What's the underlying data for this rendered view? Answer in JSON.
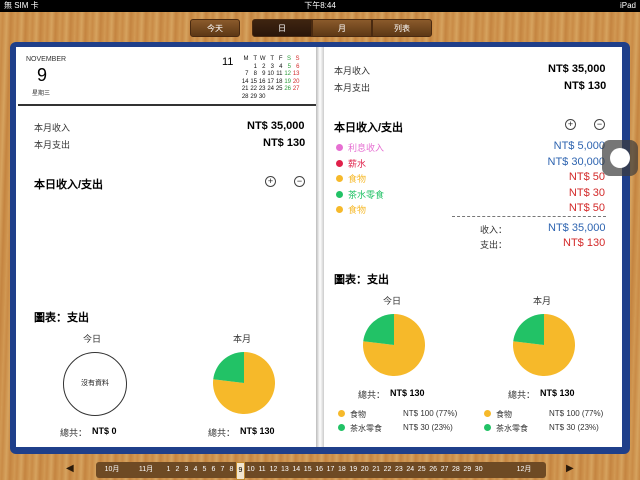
{
  "status": {
    "carrier": "無 SIM 卡",
    "time": "下午8:44",
    "ipad": "iPad"
  },
  "segments": {
    "today": "今天",
    "day": "日",
    "month": "月",
    "list": "列表"
  },
  "left": {
    "cal_month": "NOVEMBER",
    "cal_day": "9",
    "cal_weekday": "星期三",
    "mini_month": "11",
    "cal_head": [
      "M",
      "T",
      "W",
      "T",
      "F",
      "S",
      "S"
    ],
    "cal_rows": [
      [
        "",
        "1",
        "2",
        "3",
        "4",
        "5",
        "6"
      ],
      [
        "7",
        "8",
        "9",
        "10",
        "11",
        "12",
        "13"
      ],
      [
        "14",
        "15",
        "16",
        "17",
        "18",
        "19",
        "20"
      ],
      [
        "21",
        "22",
        "23",
        "24",
        "25",
        "26",
        "27"
      ],
      [
        "28",
        "29",
        "30",
        "",
        "",
        "",
        ""
      ]
    ],
    "income_label": "本月收入",
    "income_value": "NT$ 35,000",
    "expense_label": "本月支出",
    "expense_value": "NT$ 130",
    "day_title": "本日收入/支出",
    "chart_title": "圖表：支出",
    "today": "今日",
    "month": "本月",
    "no_data": "沒有資料",
    "total_today": "總共：",
    "total_today_value": "NT$ 0",
    "total_month": "總共：",
    "total_month_value": "NT$ 130"
  },
  "right": {
    "income_label": "本月收入",
    "income_value": "NT$ 35,000",
    "expense_label": "本月支出",
    "expense_value": "NT$ 130",
    "day_title": "本日收入/支出",
    "items": [
      {
        "label": "利息收入",
        "value": "NT$ 5,000",
        "dot": "#e66fd2",
        "label_color": "#e66fd2",
        "value_color": "#2e64b0"
      },
      {
        "label": "薪水",
        "value": "NT$ 30,000",
        "dot": "#e0204a",
        "label_color": "#e0204a",
        "value_color": "#2e64b0"
      },
      {
        "label": "食物",
        "value": "NT$ 50",
        "dot": "#f6b92a",
        "label_color": "#f6b92a",
        "value_color": "#d32a2a"
      },
      {
        "label": "茶水零食",
        "value": "NT$ 30",
        "dot": "#22c266",
        "label_color": "#22c266",
        "value_color": "#d32a2a"
      },
      {
        "label": "食物",
        "value": "NT$ 50",
        "dot": "#f6b92a",
        "label_color": "#f6b92a",
        "value_color": "#d32a2a"
      }
    ],
    "sum_income_label": "收入：",
    "sum_income_value": "NT$ 35,000",
    "sum_expense_label": "支出：",
    "sum_expense_value": "NT$ 130",
    "chart_title": "圖表：支出",
    "today": "今日",
    "month": "本月",
    "total_today": "總共：",
    "total_today_value": "NT$ 130",
    "total_month": "總共：",
    "total_month_value": "NT$ 130",
    "legend_today": [
      {
        "label": "食物",
        "value": "NT$ 100 (77%)"
      },
      {
        "label": "茶水零食",
        "value": "NT$ 30 (23%)"
      }
    ],
    "legend_month": [
      {
        "label": "食物",
        "value": "NT$ 100 (77%)"
      },
      {
        "label": "茶水零食",
        "value": "NT$ 30 (23%)"
      }
    ]
  },
  "chart_data": {
    "type": "pie",
    "categories": [
      "食物",
      "茶水零食"
    ],
    "values": [
      100,
      30
    ],
    "colors": [
      "#f6b92a",
      "#22c266"
    ]
  },
  "timeline": {
    "oct": "10月",
    "nov": "11月",
    "dec": "12月",
    "days": [
      "1",
      "2",
      "3",
      "4",
      "5",
      "6",
      "7",
      "8",
      "9",
      "10",
      "11",
      "12",
      "13",
      "14",
      "15",
      "16",
      "17",
      "18",
      "19",
      "20",
      "21",
      "22",
      "23",
      "24",
      "25",
      "26",
      "27",
      "28",
      "29",
      "30"
    ],
    "selected": "9"
  }
}
